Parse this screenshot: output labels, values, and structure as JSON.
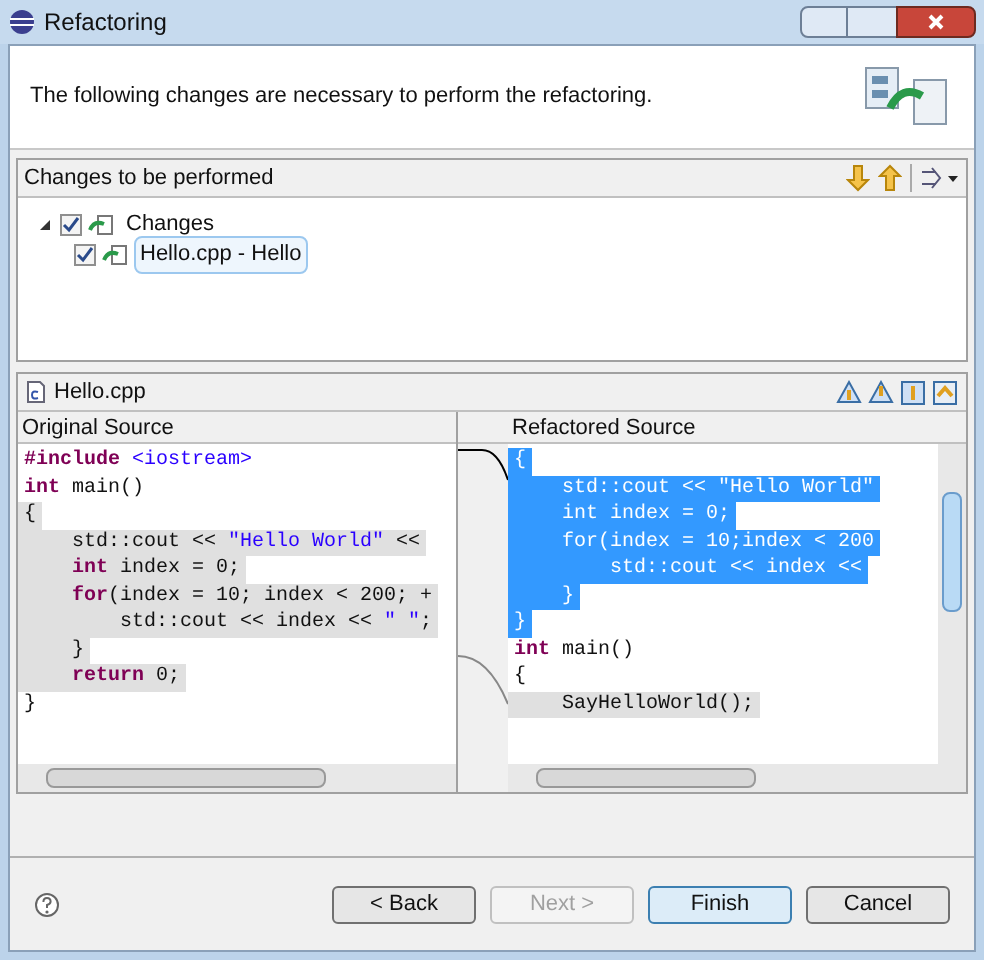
{
  "window": {
    "title": "Refactoring"
  },
  "header": {
    "message": "The following changes are necessary to perform the refactoring."
  },
  "changes_panel": {
    "title": "Changes to be performed",
    "tree": [
      {
        "label": "Changes",
        "checked": true,
        "expanded": true,
        "selected": false,
        "children": [
          {
            "label": "Hello.cpp - Hello",
            "checked": true,
            "selected": true
          }
        ]
      }
    ]
  },
  "compare": {
    "file": "Hello.cpp",
    "original": {
      "title": "Original Source",
      "lines": [
        {
          "changed": false,
          "segments": [
            {
              "kind": "preproc",
              "text": "#include"
            },
            {
              "kind": "string",
              "text": " <iostream>"
            }
          ]
        },
        {
          "changed": false,
          "segments": [
            {
              "kind": "keyword",
              "text": "int"
            },
            {
              "kind": "plain",
              "text": " main()"
            }
          ]
        },
        {
          "changed": true,
          "segments": [
            {
              "kind": "plain",
              "text": "{"
            }
          ]
        },
        {
          "changed": true,
          "segments": [
            {
              "kind": "plain",
              "text": "    std::cout << "
            },
            {
              "kind": "string",
              "text": "\"Hello World\""
            },
            {
              "kind": "plain",
              "text": " <<"
            }
          ]
        },
        {
          "changed": true,
          "segments": [
            {
              "kind": "keyword",
              "text": "    int"
            },
            {
              "kind": "plain",
              "text": " index = 0;"
            }
          ]
        },
        {
          "changed": true,
          "segments": [
            {
              "kind": "keyword",
              "text": "    for"
            },
            {
              "kind": "plain",
              "text": "(index = 10; index < 200; +"
            }
          ]
        },
        {
          "changed": true,
          "segments": [
            {
              "kind": "plain",
              "text": "        std::cout << index << "
            },
            {
              "kind": "string",
              "text": "\" \""
            },
            {
              "kind": "plain",
              "text": ";"
            }
          ]
        },
        {
          "changed": true,
          "segments": [
            {
              "kind": "plain",
              "text": "    }"
            }
          ]
        },
        {
          "changed": true,
          "segments": [
            {
              "kind": "keyword",
              "text": "    return"
            },
            {
              "kind": "plain",
              "text": " 0;"
            }
          ]
        },
        {
          "changed": false,
          "segments": [
            {
              "kind": "plain",
              "text": "}"
            }
          ]
        }
      ]
    },
    "refactored": {
      "title": "Refactored Source",
      "lines": [
        {
          "selected": true,
          "changed": true,
          "segments": [
            {
              "kind": "plain",
              "text": "{"
            }
          ]
        },
        {
          "selected": true,
          "changed": true,
          "segments": [
            {
              "kind": "plain",
              "text": "    std::cout << "
            },
            {
              "kind": "string",
              "text": "\"Hello World\""
            }
          ]
        },
        {
          "selected": true,
          "changed": true,
          "segments": [
            {
              "kind": "keyword",
              "text": "    int"
            },
            {
              "kind": "plain",
              "text": " index = 0;"
            }
          ]
        },
        {
          "selected": true,
          "changed": true,
          "segments": [
            {
              "kind": "keyword",
              "text": "    for"
            },
            {
              "kind": "plain",
              "text": "(index = 10;index < 200"
            }
          ]
        },
        {
          "selected": true,
          "changed": true,
          "segments": [
            {
              "kind": "plain",
              "text": "        std::cout << index <<"
            }
          ]
        },
        {
          "selected": true,
          "changed": true,
          "segments": [
            {
              "kind": "plain",
              "text": "    }"
            }
          ]
        },
        {
          "selected": true,
          "changed": true,
          "segments": [
            {
              "kind": "plain",
              "text": "}"
            }
          ]
        },
        {
          "selected": false,
          "changed": false,
          "segments": [
            {
              "kind": "keyword",
              "text": "int"
            },
            {
              "kind": "plain",
              "text": " main()"
            }
          ]
        },
        {
          "selected": false,
          "changed": false,
          "segments": [
            {
              "kind": "plain",
              "text": "{"
            }
          ]
        },
        {
          "selected": false,
          "changed": true,
          "segments": [
            {
              "kind": "plain",
              "text": "    SayHelloWorld();"
            }
          ]
        }
      ]
    }
  },
  "buttons": [
    {
      "label": "< Back",
      "disabled": false,
      "default": false
    },
    {
      "label": "Next >",
      "disabled": true,
      "default": false
    },
    {
      "label": "Finish",
      "disabled": false,
      "default": true
    },
    {
      "label": "Cancel",
      "disabled": false,
      "default": false
    }
  ]
}
